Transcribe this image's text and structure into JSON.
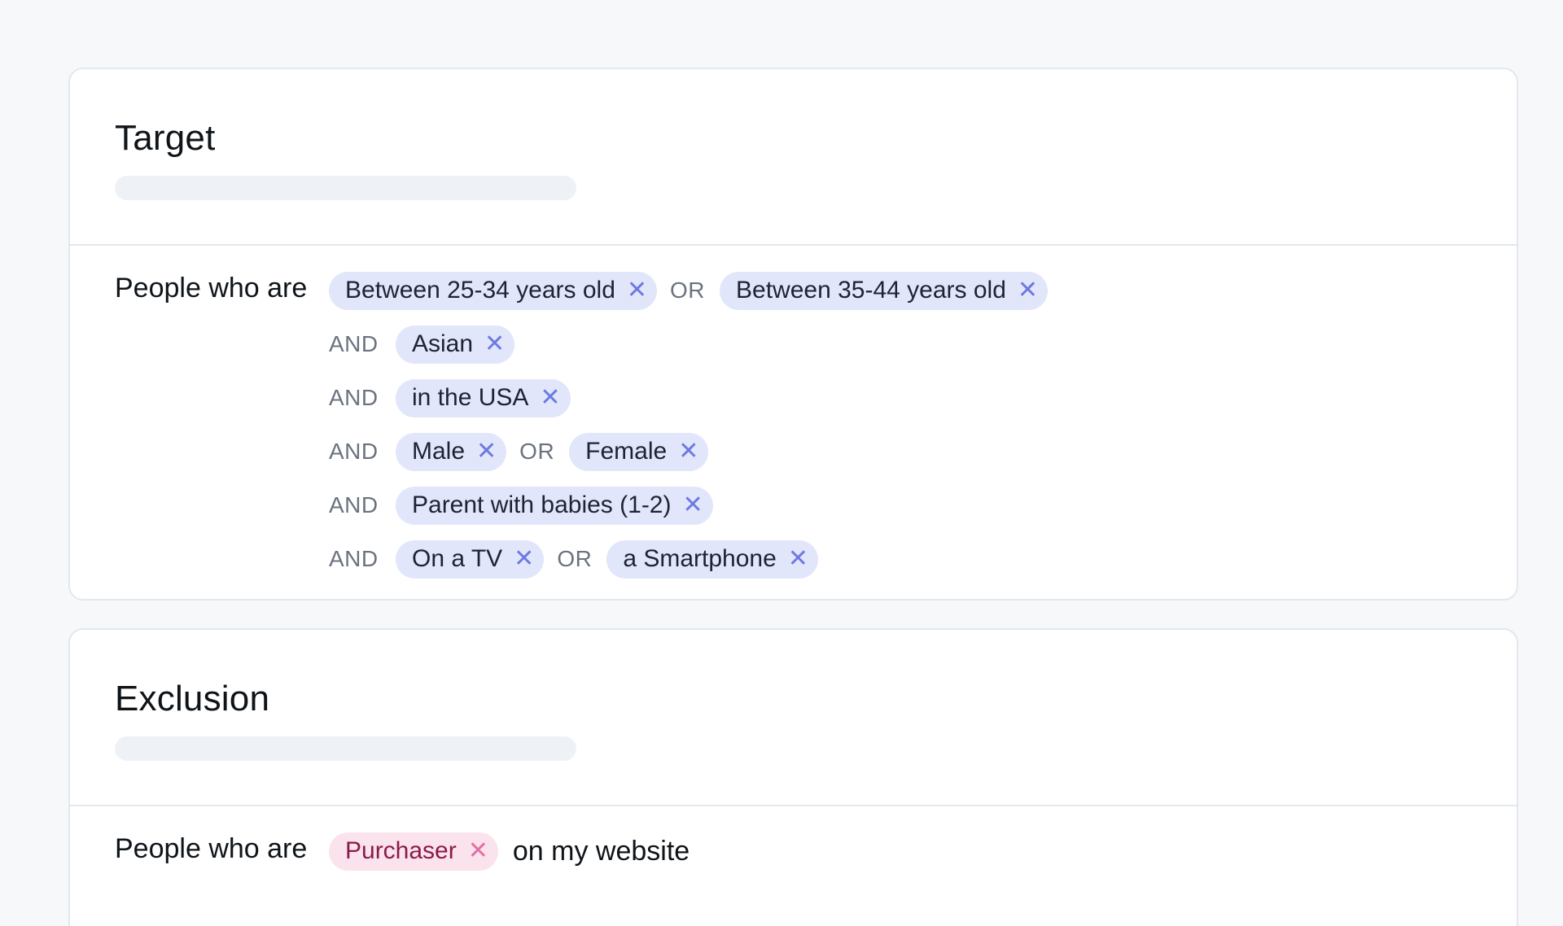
{
  "target": {
    "title": "Target",
    "lead": "People who are",
    "rows": [
      {
        "prefix": "",
        "chips": [
          "Between 25-34 years old",
          "Between 35-44 years old"
        ],
        "joiner": "OR"
      },
      {
        "prefix": "AND",
        "chips": [
          "Asian"
        ]
      },
      {
        "prefix": "AND",
        "chips": [
          "in the USA"
        ]
      },
      {
        "prefix": "AND",
        "chips": [
          "Male",
          "Female"
        ],
        "joiner": "OR"
      },
      {
        "prefix": "AND",
        "chips": [
          "Parent with babies (1-2)"
        ]
      },
      {
        "prefix": "AND",
        "chips": [
          "On a TV",
          "a Smartphone"
        ],
        "joiner": "OR"
      }
    ]
  },
  "exclusion": {
    "title": "Exclusion",
    "lead": "People who are",
    "chip": "Purchaser",
    "trail": "on my website"
  },
  "icons": {
    "remove": "close-icon",
    "remove_glyph": "✕"
  },
  "colors": {
    "chip_bg": "#e1e6fb",
    "chip_x": "#6d79e0",
    "exclusion_chip_bg": "#fbe3ee",
    "exclusion_chip_text": "#8b1a4a",
    "exclusion_chip_x": "#e56fa3"
  }
}
